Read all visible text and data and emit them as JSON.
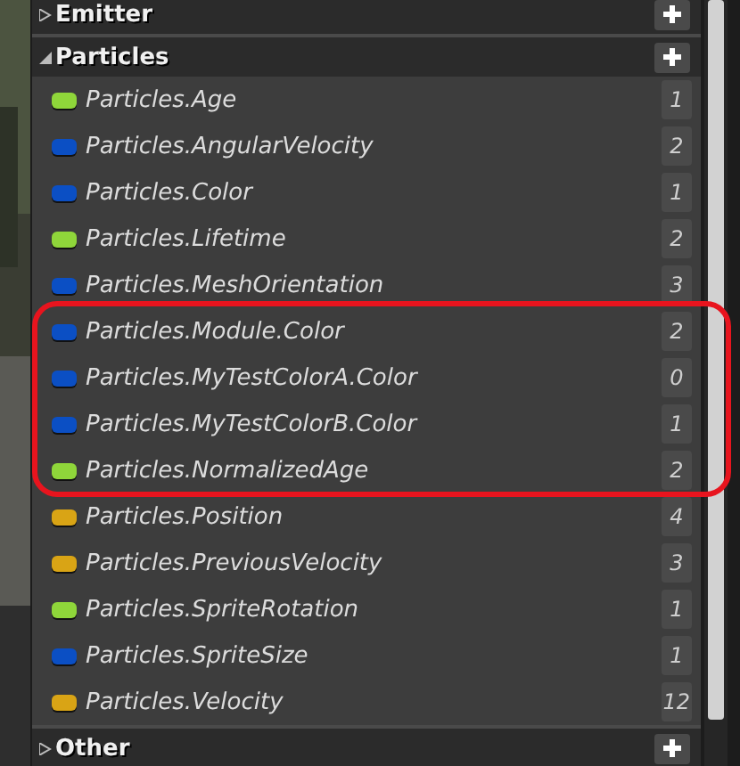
{
  "sections": [
    {
      "title": "Emitter",
      "expanded": false
    },
    {
      "title": "Particles",
      "expanded": true,
      "items": [
        {
          "name": "Particles.Age",
          "color": "#8fd63a",
          "count": "1"
        },
        {
          "name": "Particles.AngularVelocity",
          "color": "#0b4fc4",
          "count": "2"
        },
        {
          "name": "Particles.Color",
          "color": "#0b4fc4",
          "count": "1"
        },
        {
          "name": "Particles.Lifetime",
          "color": "#8fd63a",
          "count": "2"
        },
        {
          "name": "Particles.MeshOrientation",
          "color": "#0b4fc4",
          "count": "3"
        },
        {
          "name": "Particles.Module.Color",
          "color": "#0b4fc4",
          "count": "2"
        },
        {
          "name": "Particles.MyTestColorA.Color",
          "color": "#0b4fc4",
          "count": "0"
        },
        {
          "name": "Particles.MyTestColorB.Color",
          "color": "#0b4fc4",
          "count": "1"
        },
        {
          "name": "Particles.NormalizedAge",
          "color": "#8fd63a",
          "count": "2"
        },
        {
          "name": "Particles.Position",
          "color": "#d9a415",
          "count": "4"
        },
        {
          "name": "Particles.PreviousVelocity",
          "color": "#d9a415",
          "count": "3"
        },
        {
          "name": "Particles.SpriteRotation",
          "color": "#8fd63a",
          "count": "1"
        },
        {
          "name": "Particles.SpriteSize",
          "color": "#0b4fc4",
          "count": "1"
        },
        {
          "name": "Particles.Velocity",
          "color": "#d9a415",
          "count": "12"
        }
      ]
    },
    {
      "title": "Other",
      "expanded": false
    }
  ]
}
